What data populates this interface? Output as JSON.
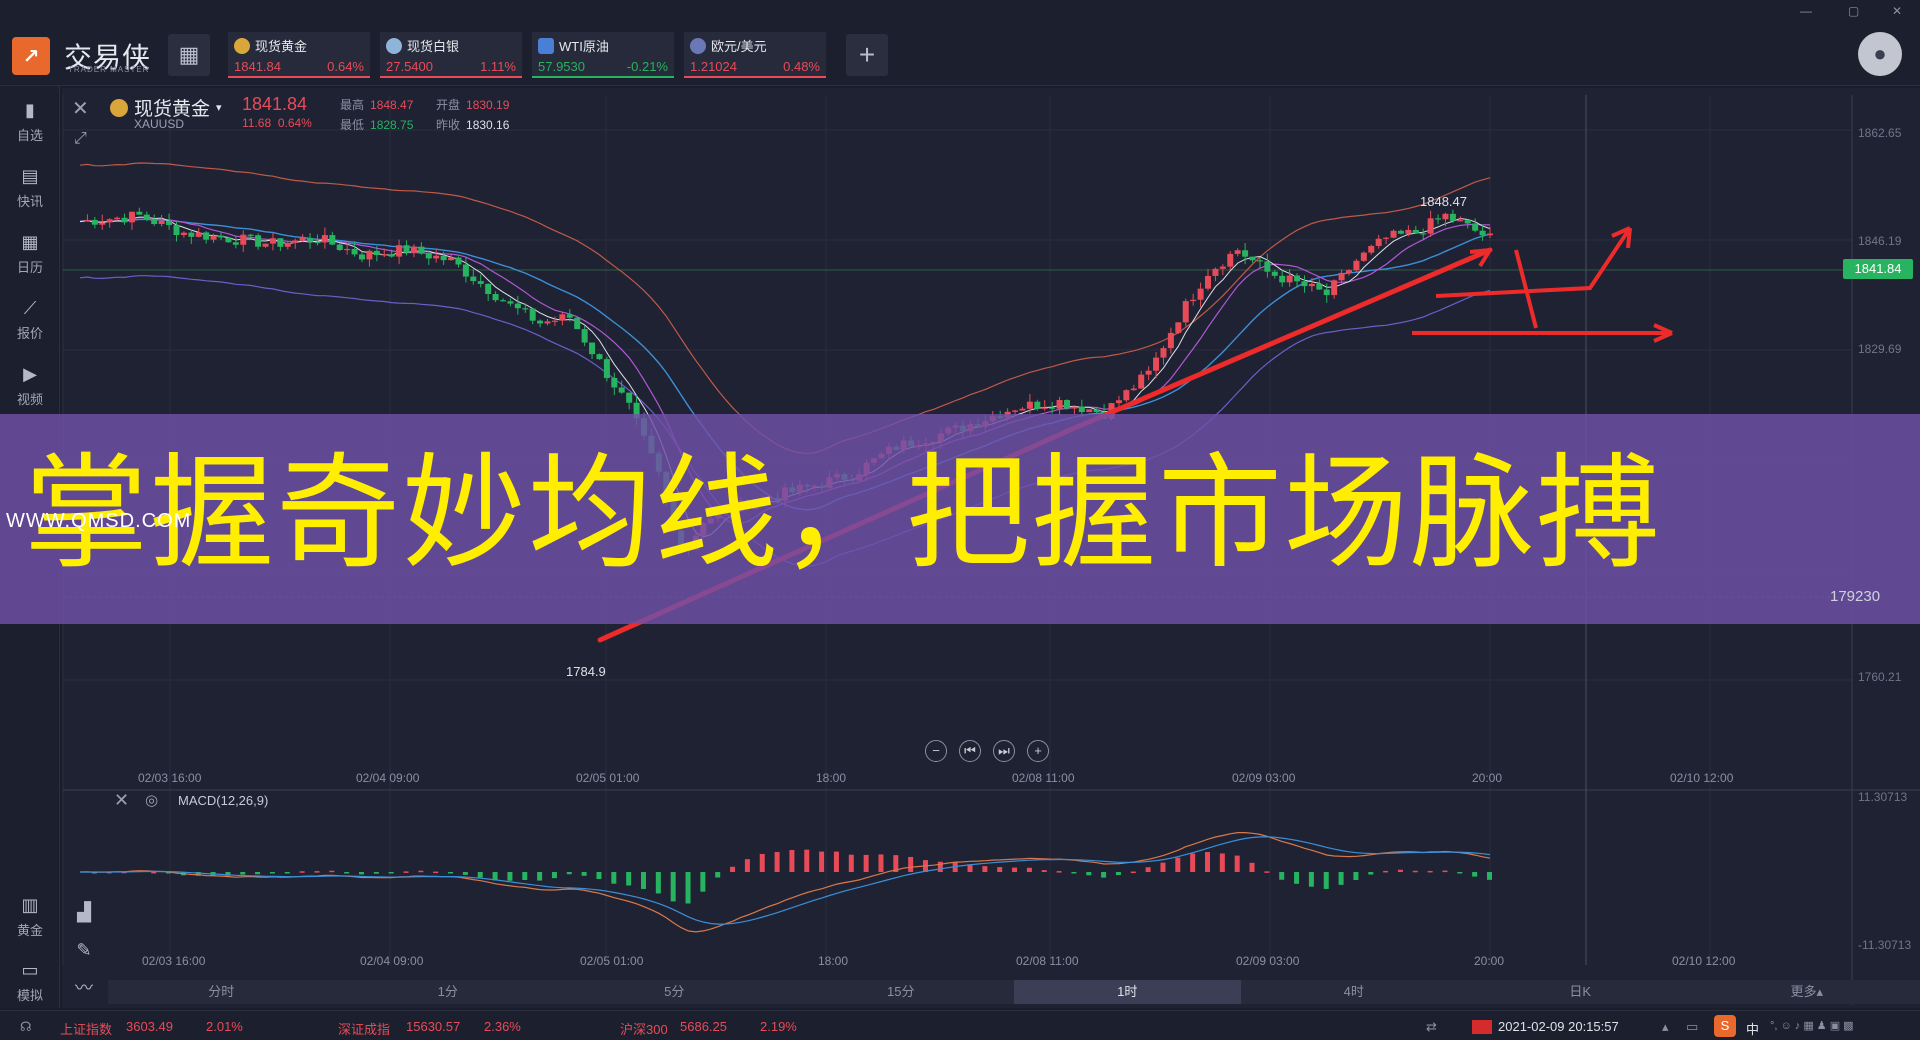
{
  "app": {
    "name": "交易侠",
    "subtitle": "TRADER MASTER",
    "logo_icon": "chart-logo-icon"
  },
  "window_controls": [
    "—",
    "▢",
    "✕"
  ],
  "tickers": [
    {
      "name": "现货黄金",
      "price": "1841.84",
      "change": "0.64%",
      "dir": "up",
      "icon": "gold-coin-icon"
    },
    {
      "name": "现货白银",
      "price": "27.5400",
      "change": "1.11%",
      "dir": "up",
      "icon": "silver-coin-icon"
    },
    {
      "name": "WTI原油",
      "price": "57.9530",
      "change": "-0.21%",
      "dir": "down",
      "icon": "oil-icon"
    },
    {
      "name": "欧元/美元",
      "price": "1.21024",
      "change": "0.48%",
      "dir": "up",
      "icon": "flag-icon"
    }
  ],
  "sidebar": {
    "top": [
      {
        "label": "自选",
        "icon": "bookmark-icon"
      },
      {
        "label": "快讯",
        "icon": "news-icon"
      },
      {
        "label": "日历",
        "icon": "calendar-icon"
      },
      {
        "label": "报价",
        "icon": "quote-chart-icon"
      },
      {
        "label": "视频",
        "icon": "video-icon"
      }
    ],
    "bottom": [
      {
        "label": "黄金",
        "icon": "gold-bar-icon"
      },
      {
        "label": "模拟",
        "icon": "simulate-icon"
      }
    ]
  },
  "symbol": {
    "name": "现货黄金",
    "code": "XAUUSD",
    "price": "1841.84",
    "change_abs": "11.68",
    "change_pct": "0.64%",
    "high_label": "最高",
    "high": "1848.47",
    "low_label": "最低",
    "low": "1828.75",
    "open_label": "开盘",
    "open": "1830.19",
    "prev_label": "昨收",
    "prev": "1830.16"
  },
  "main_chart": {
    "y_ticks": [
      "1862.65",
      "1846.19",
      "1829.69",
      "1760.21"
    ],
    "current_price": "1841.84",
    "annotations": {
      "high": "1848.47",
      "low": "1784.9"
    },
    "cursor_price": "179230",
    "x_ticks": [
      "02/03 16:00",
      "02/04 09:00",
      "02/05 01:00",
      "18:00",
      "02/08 11:00",
      "02/09 03:00",
      "20:00",
      "02/10 12:00"
    ]
  },
  "chart_data": {
    "type": "line",
    "title": "",
    "xlabel": "",
    "ylabel": "",
    "ylim": [
      1760,
      1863
    ],
    "x": [
      "02/03 16:00",
      "02/04 09:00",
      "02/05 01:00",
      "02/05 18:00",
      "02/08 11:00",
      "02/09 03:00",
      "02/09 20:00"
    ],
    "series": [
      {
        "values": [
          1845,
          1842,
          1836,
          1790,
          1802,
          1812,
          1830,
          1841,
          1842
        ]
      }
    ]
  },
  "macd": {
    "label": "MACD(12,26,9)",
    "y_top": "11.30713",
    "y_bottom": "-11.30713",
    "x_ticks": [
      "02/03 16:00",
      "02/04 09:00",
      "02/05 01:00",
      "18:00",
      "02/08 11:00",
      "02/09 03:00",
      "20:00",
      "02/10 12:00"
    ]
  },
  "timeframes": [
    {
      "label": "分时",
      "active": false
    },
    {
      "label": "1分",
      "active": false
    },
    {
      "label": "5分",
      "active": false
    },
    {
      "label": "15分",
      "active": false
    },
    {
      "label": "1时",
      "active": true
    },
    {
      "label": "4时",
      "active": false
    },
    {
      "label": "日K",
      "active": false
    },
    {
      "label": "更多▴",
      "active": false
    }
  ],
  "statusbar": {
    "sh_label": "上证指数",
    "sh_value": "3603.49",
    "sh_pct": "2.01%",
    "sz_label": "深证成指",
    "sz_value": "15630.57",
    "sz_pct": "2.36%",
    "hs_label": "沪深300",
    "hs_value": "5686.25",
    "hs_pct": "2.19%",
    "datetime": "2021-02-09 20:15:57",
    "ime": "中"
  },
  "overlay": {
    "headline": "掌握奇妙均线，把握市场脉搏",
    "watermark": "WWW.QMSD.COM"
  },
  "colors": {
    "up": "#e84b58",
    "down": "#27b35f",
    "banner": "#7050a8",
    "headline": "#ffee00",
    "arrow": "#ee2b2b"
  }
}
